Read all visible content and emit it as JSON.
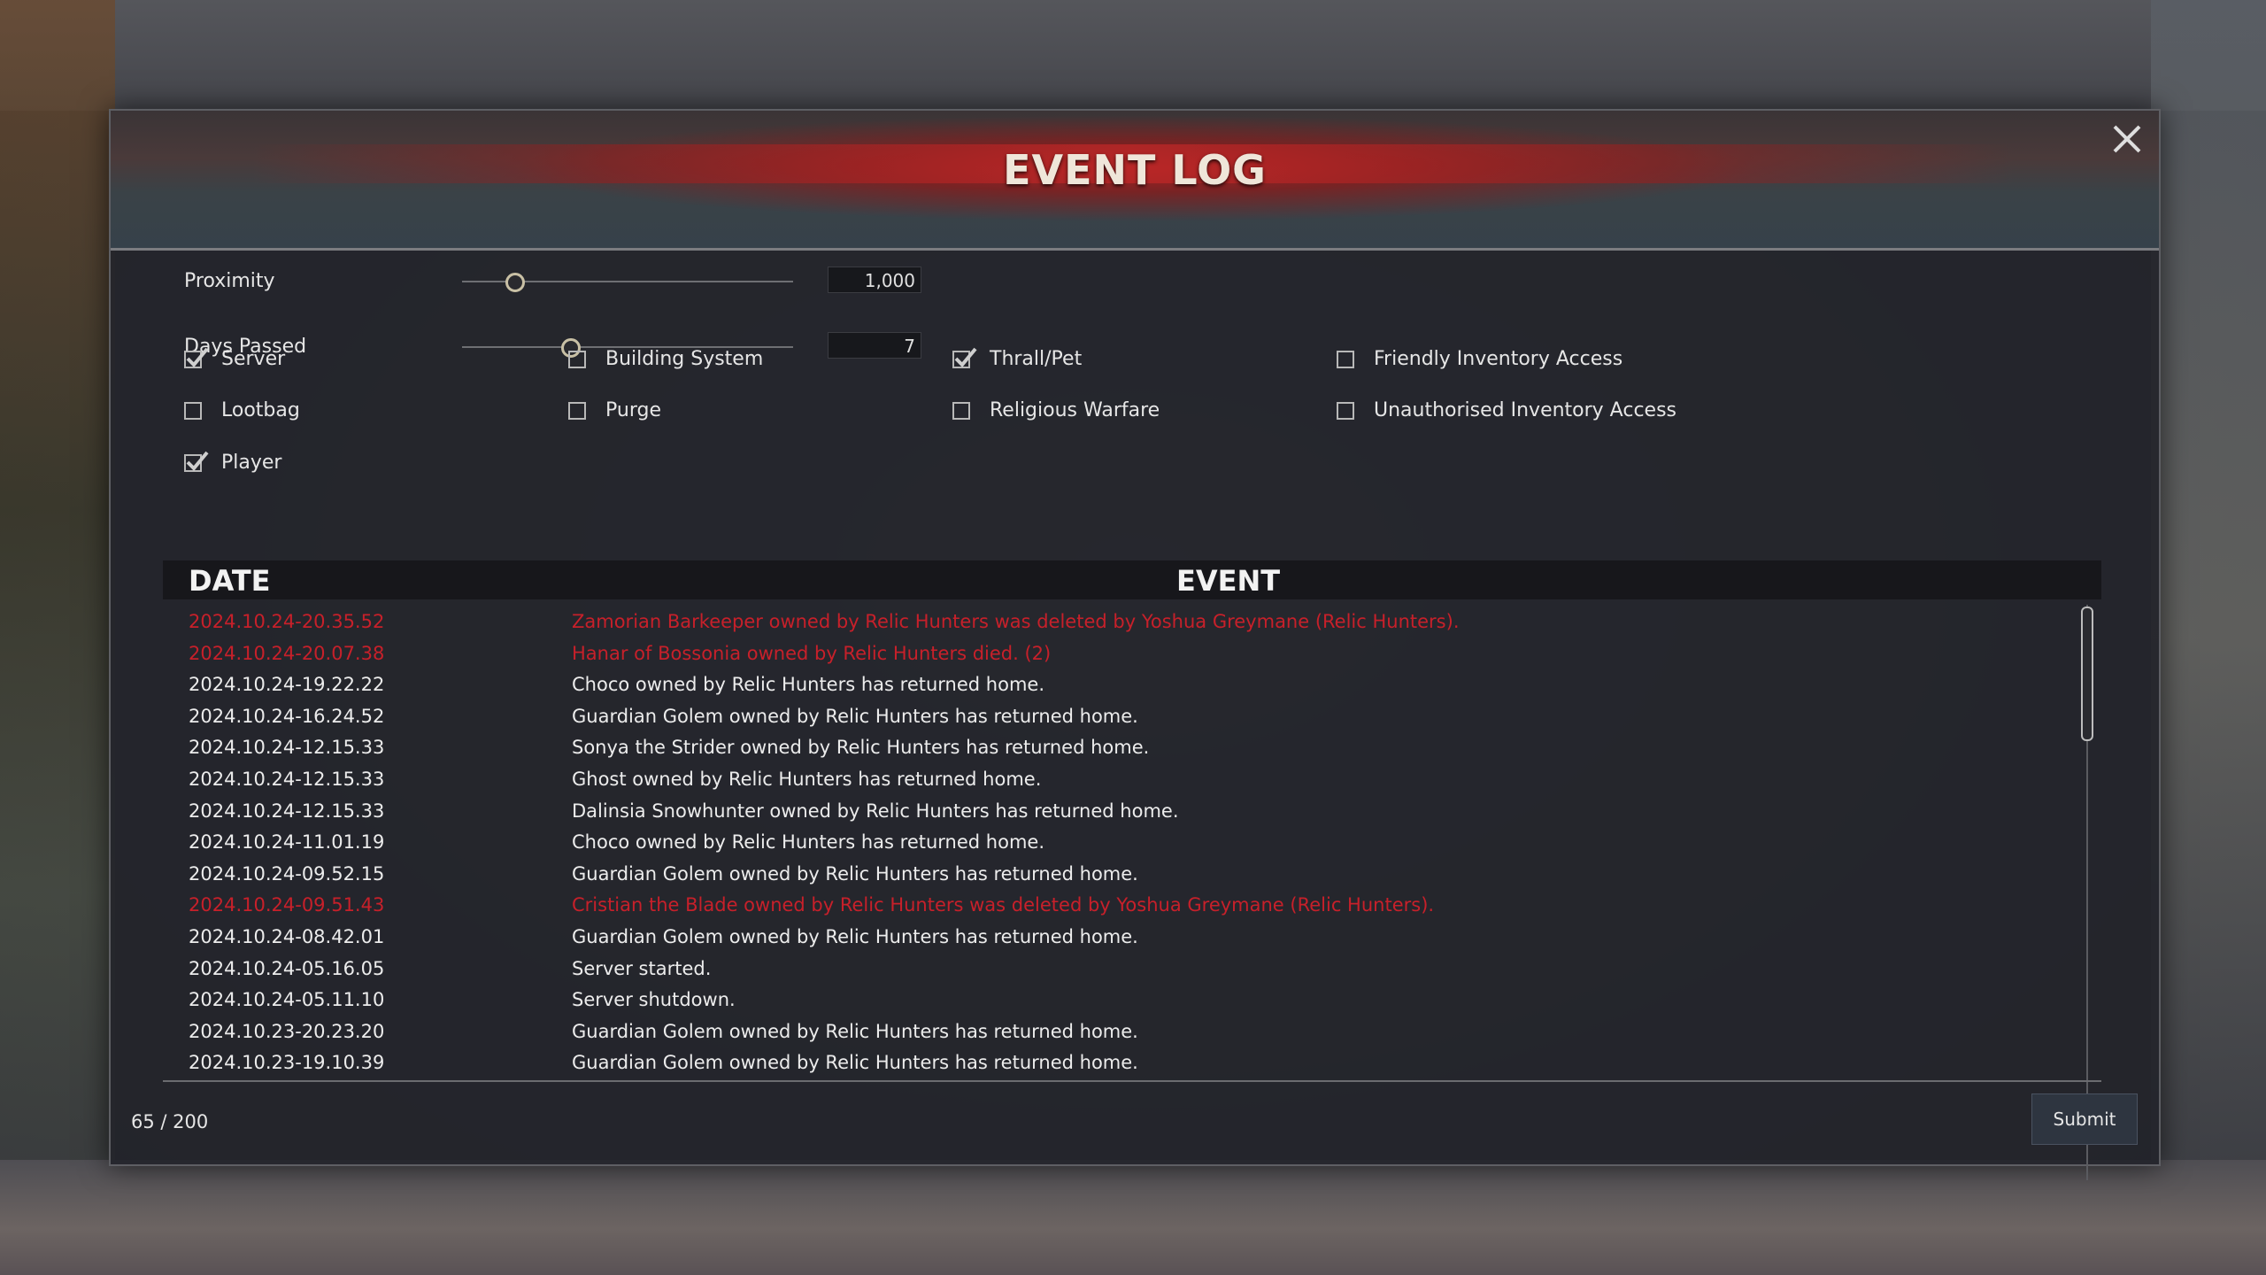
{
  "window": {
    "title": "EVENT LOG",
    "close_icon": "close-icon"
  },
  "filters": {
    "proximity": {
      "label": "Proximity",
      "value": "1,000",
      "level": 0.16
    },
    "days_passed": {
      "label": "Days Passed",
      "value": "7",
      "level": 0.33
    }
  },
  "checkboxes": [
    {
      "label": "Server",
      "checked": true
    },
    {
      "label": "Building System",
      "checked": false
    },
    {
      "label": "Thrall/Pet",
      "checked": true
    },
    {
      "label": "Friendly Inventory Access",
      "checked": false
    },
    {
      "label": "Lootbag",
      "checked": false
    },
    {
      "label": "Purge",
      "checked": false
    },
    {
      "label": "Religious Warfare",
      "checked": false
    },
    {
      "label": "Unauthorised Inventory Access",
      "checked": false
    },
    {
      "label": "Player",
      "checked": true
    }
  ],
  "table": {
    "headers": {
      "date": "DATE",
      "event": "EVENT"
    },
    "rows": [
      {
        "date": "2024.10.24-20.35.52",
        "event": "Zamorian Barkeeper owned by Relic Hunters was deleted by Yoshua Greymane (Relic Hunters).",
        "highlight": "red"
      },
      {
        "date": "2024.10.24-20.07.38",
        "event": "Hanar of Bossonia owned by Relic Hunters died. (2)",
        "highlight": "red"
      },
      {
        "date": "2024.10.24-19.22.22",
        "event": "Choco owned by Relic Hunters has returned home.",
        "highlight": "white"
      },
      {
        "date": "2024.10.24-16.24.52",
        "event": "Guardian Golem owned by Relic Hunters has returned home.",
        "highlight": "white"
      },
      {
        "date": "2024.10.24-12.15.33",
        "event": "Sonya the Strider owned by Relic Hunters has returned home.",
        "highlight": "white"
      },
      {
        "date": "2024.10.24-12.15.33",
        "event": "Ghost owned by Relic Hunters has returned home.",
        "highlight": "white"
      },
      {
        "date": "2024.10.24-12.15.33",
        "event": "Dalinsia Snowhunter owned by Relic Hunters has returned home.",
        "highlight": "white"
      },
      {
        "date": "2024.10.24-11.01.19",
        "event": "Choco owned by Relic Hunters has returned home.",
        "highlight": "white"
      },
      {
        "date": "2024.10.24-09.52.15",
        "event": "Guardian Golem owned by Relic Hunters has returned home.",
        "highlight": "white"
      },
      {
        "date": "2024.10.24-09.51.43",
        "event": "Cristian the Blade owned by Relic Hunters was deleted by Yoshua Greymane (Relic Hunters).",
        "highlight": "red"
      },
      {
        "date": "2024.10.24-08.42.01",
        "event": "Guardian Golem owned by Relic Hunters has returned home.",
        "highlight": "white"
      },
      {
        "date": "2024.10.24-05.16.05",
        "event": "Server started.",
        "highlight": "white"
      },
      {
        "date": "2024.10.24-05.11.10",
        "event": "Server shutdown.",
        "highlight": "white"
      },
      {
        "date": "2024.10.23-20.23.20",
        "event": "Guardian Golem owned by Relic Hunters has returned home.",
        "highlight": "white"
      },
      {
        "date": "2024.10.23-19.10.39",
        "event": "Guardian Golem owned by Relic Hunters has returned home.",
        "highlight": "white"
      }
    ]
  },
  "footer": {
    "page_count": "65 / 200",
    "submit_label": "Submit"
  },
  "colors": {
    "alert": "#c7202a",
    "banner_red": "#af2020",
    "panel": "#24252b"
  }
}
